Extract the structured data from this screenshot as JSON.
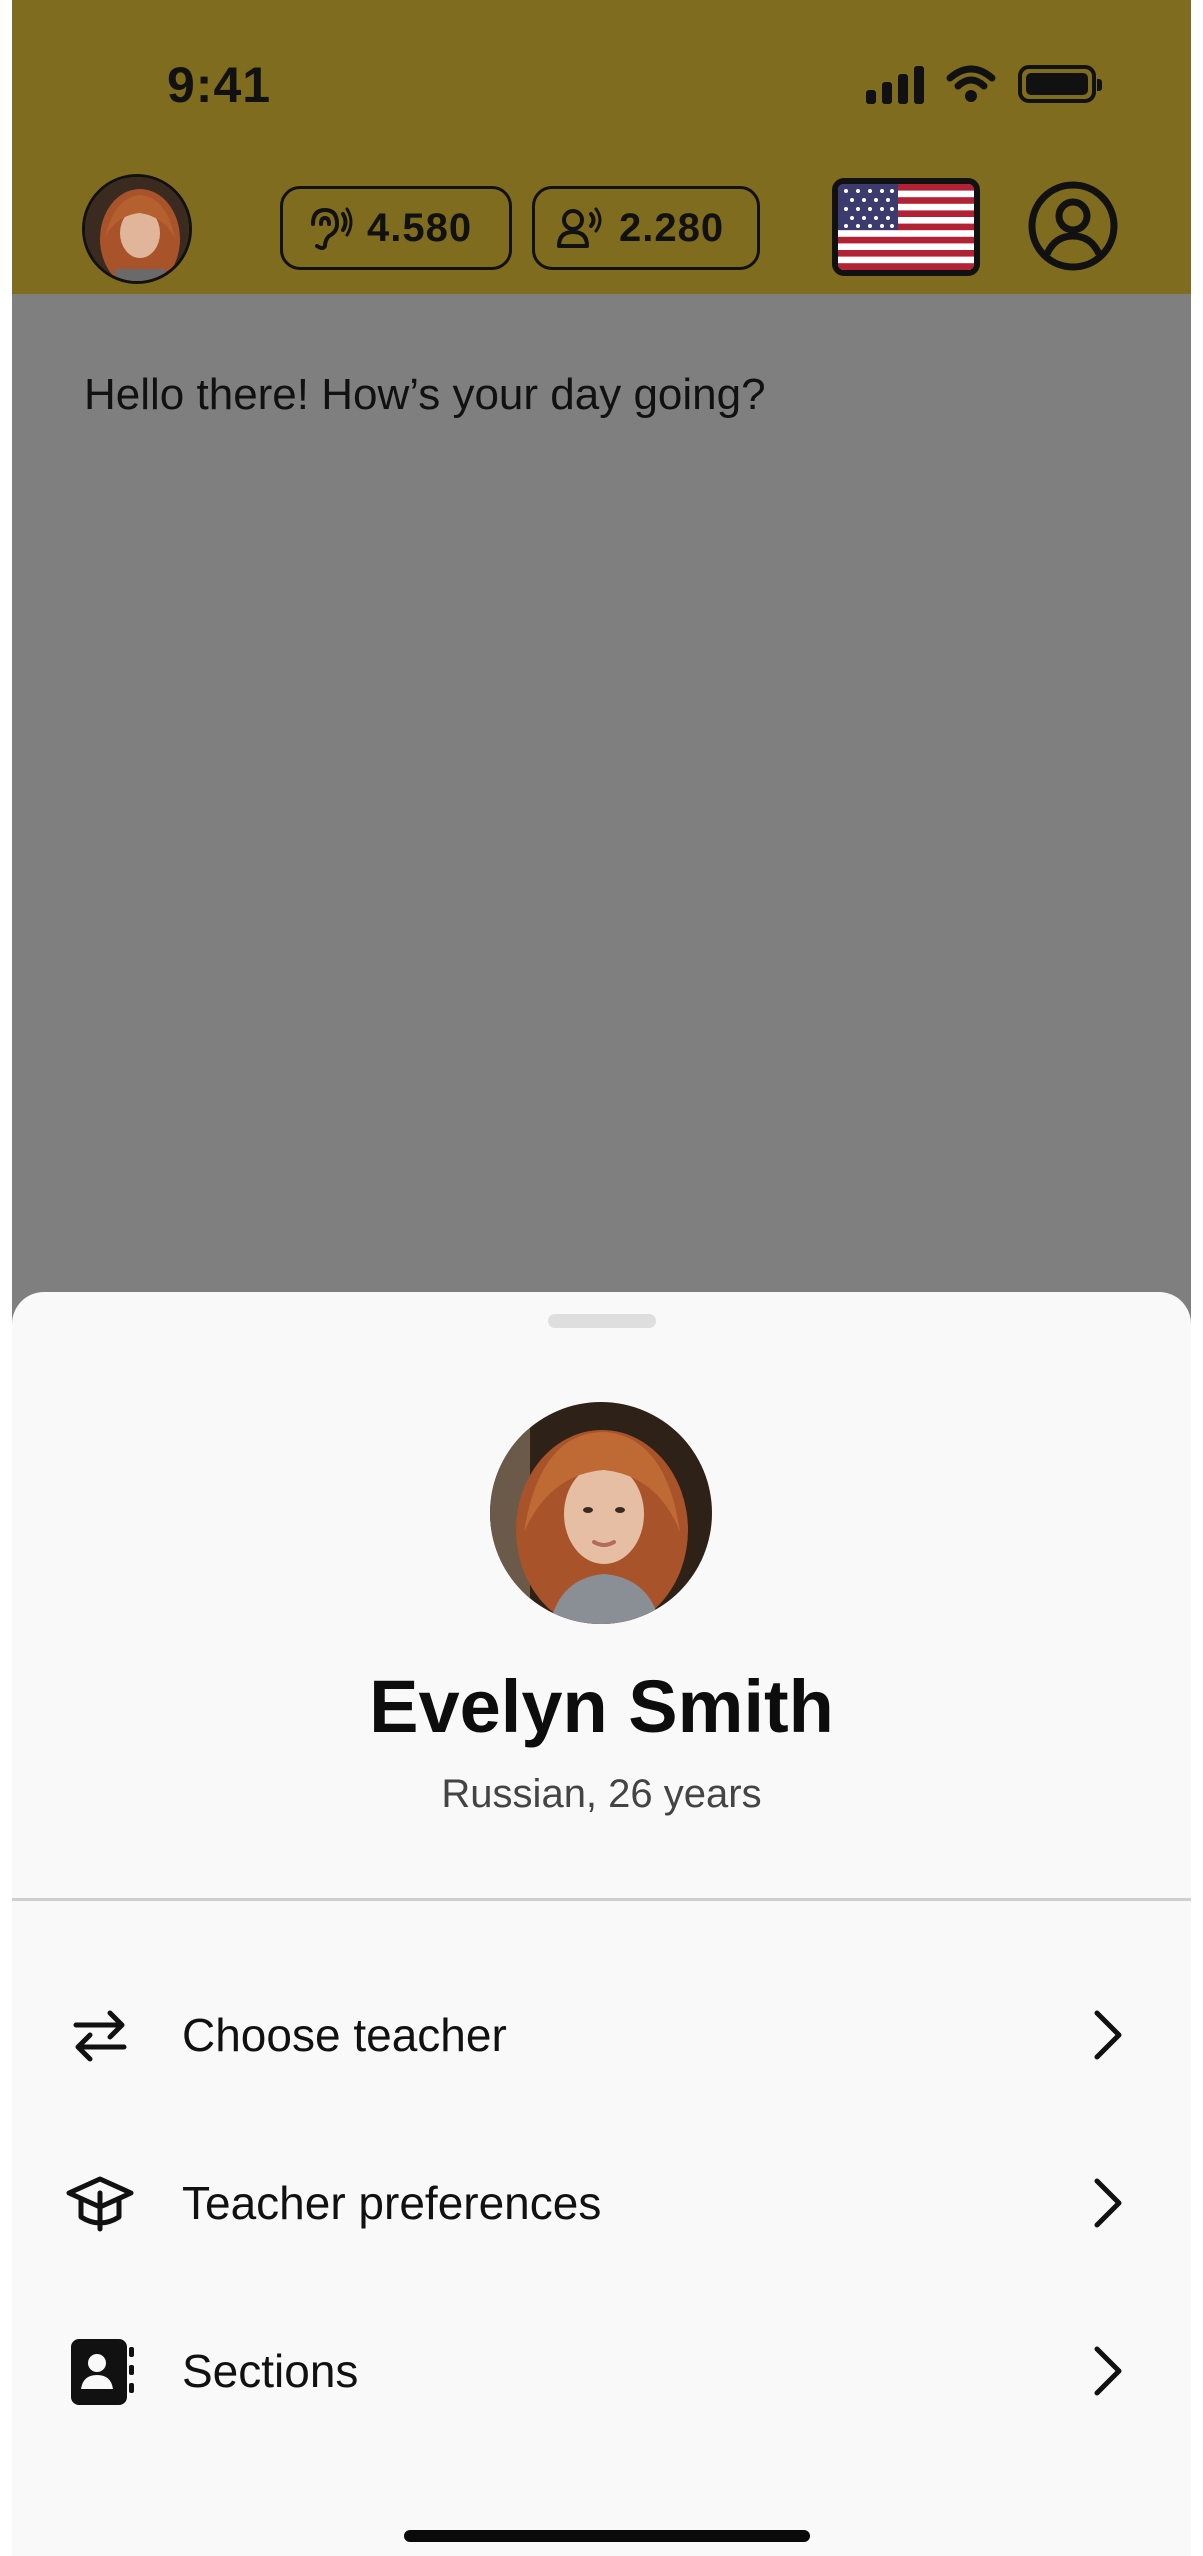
{
  "status_bar": {
    "time": "9:41"
  },
  "header": {
    "listen_count": "4.580",
    "speak_count": "2.280",
    "language_flag": "us-flag"
  },
  "chat": {
    "message": "Hello there! How’s your day going?"
  },
  "teacher": {
    "name": "Evelyn Smith",
    "details": "Russian, 26 years"
  },
  "menu": {
    "items": [
      {
        "label": "Choose teacher",
        "icon": "swap-arrows-icon"
      },
      {
        "label": "Teacher preferences",
        "icon": "graduation-cap-icon"
      },
      {
        "label": "Sections",
        "icon": "contacts-book-icon"
      }
    ]
  },
  "colors": {
    "header_bg": "#806c1e",
    "dim_overlay": "#7f7f7f",
    "sheet_bg": "#f9f9f9"
  }
}
